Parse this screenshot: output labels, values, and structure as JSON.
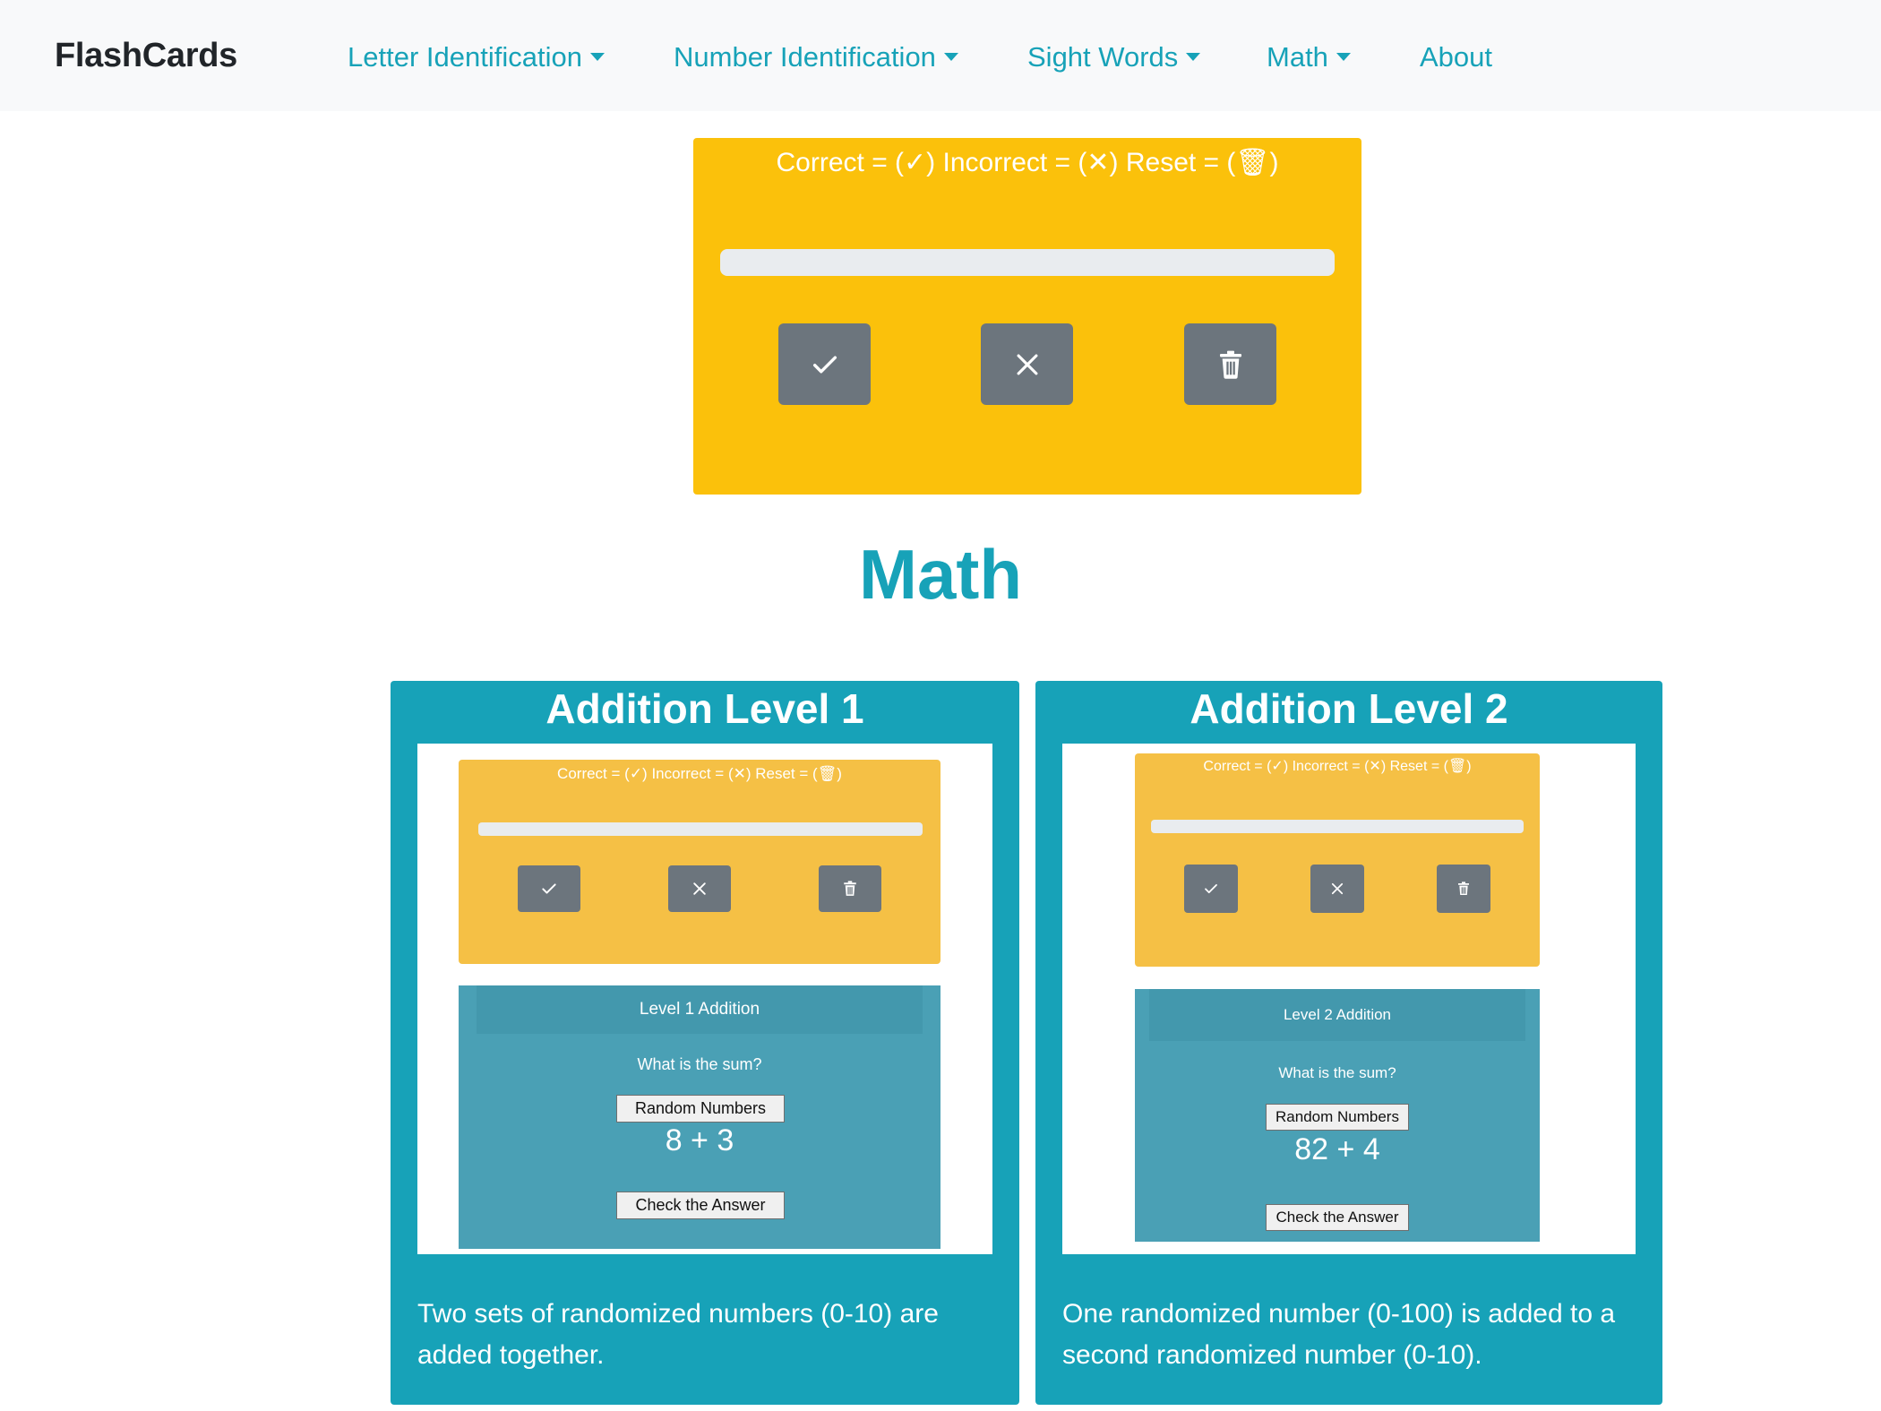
{
  "navbar": {
    "brand": "FlashCards",
    "items": [
      {
        "label": "Letter Identification",
        "dropdown": true
      },
      {
        "label": "Number Identification",
        "dropdown": true
      },
      {
        "label": "Sight Words",
        "dropdown": true
      },
      {
        "label": "Math",
        "dropdown": true
      },
      {
        "label": "About",
        "dropdown": false
      }
    ]
  },
  "flashcard": {
    "legend": "Correct = (✓) Incorrect = (✕) Reset = (🗑)",
    "buttons": {
      "correct": "check-icon",
      "incorrect": "x-icon",
      "reset": "trash-icon"
    }
  },
  "section": {
    "title": "Math"
  },
  "cards": [
    {
      "title": "Addition Level 1",
      "screenshot": {
        "legend": "Correct = (✓) Incorrect = (✕) Reset = (🗑)",
        "quiz_title": "Level 1 Addition",
        "question": "What is the sum?",
        "random_button": "Random Numbers",
        "equation": "8 + 3",
        "check_button": "Check the Answer"
      },
      "description": "Two sets of randomized numbers (0-10) are added together."
    },
    {
      "title": "Addition Level 2",
      "screenshot": {
        "legend": "Correct = (✓) Incorrect = (✕) Reset = (🗑)",
        "quiz_title": "Level 2 Addition",
        "question": "What is the sum?",
        "random_button": "Random Numbers",
        "equation": "82 + 4",
        "check_button": "Check the Answer"
      },
      "description": "One randomized number (0-100) is added to a second randomized number (0-10)."
    }
  ],
  "colors": {
    "brand_teal": "#17a2b8",
    "card_yellow": "#fbc10b",
    "button_gray": "#6c757d",
    "navbar_bg": "#f8f9fa"
  }
}
